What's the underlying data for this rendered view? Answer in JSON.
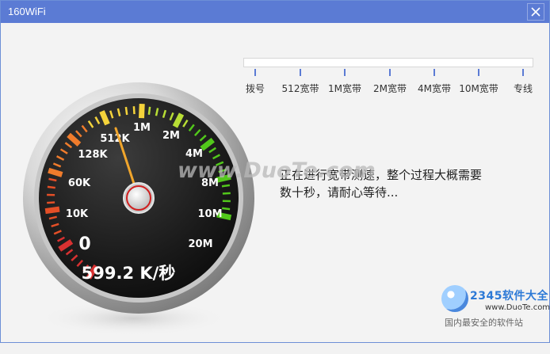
{
  "window": {
    "title": "160WiFi",
    "close_icon": "close-icon"
  },
  "gauge": {
    "labels": [
      "0",
      "10K",
      "60K",
      "128K",
      "512K",
      "1M",
      "2M",
      "4M",
      "8M",
      "10M",
      "20M"
    ],
    "speed_text": "599.2 K/秒",
    "needle_label": "512K"
  },
  "scale": {
    "labels": [
      "拨号",
      "512宽带",
      "1M宽带",
      "2M宽带",
      "4M宽带",
      "10M宽带",
      "专线"
    ]
  },
  "status": {
    "line1": "正在进行宽带测速，整个过程大概需要",
    "line2": "数十秒，请耐心等待..."
  },
  "watermark": {
    "brand": "www.DuoTe.com",
    "logo_brand": "2345软件大全",
    "logo_site": "www.DuoTe.com",
    "logo_slogan": "国内最安全的软件站"
  },
  "colors": {
    "titlebar": "#5b7bd4",
    "accent_red": "#d83131",
    "accent_orange": "#f07c2c",
    "accent_yellow": "#f4d33b",
    "accent_green": "#52c81b"
  }
}
